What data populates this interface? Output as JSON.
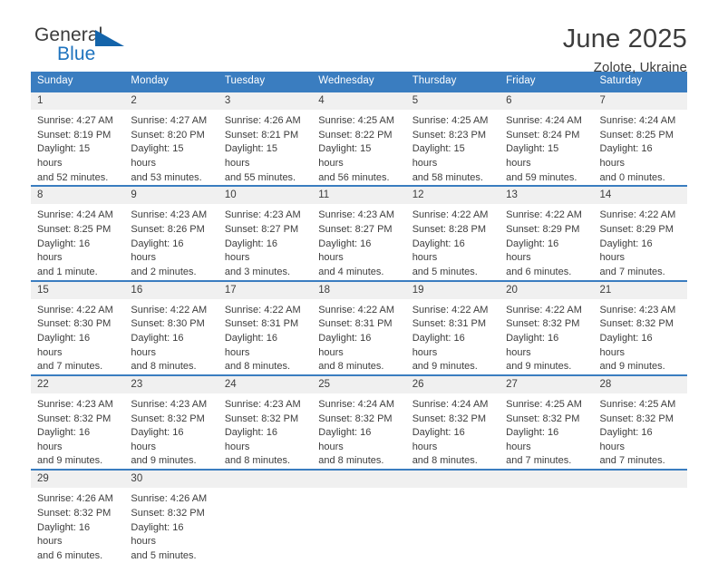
{
  "brand": {
    "name_part1": "General",
    "name_part2": "Blue",
    "accent_color": "#1464aa"
  },
  "header": {
    "title": "June 2025",
    "location": "Zolote, Ukraine"
  },
  "calendar": {
    "header_bg": "#3a7dc0",
    "daynum_bg": "#f0f0f0",
    "weekdays": [
      "Sunday",
      "Monday",
      "Tuesday",
      "Wednesday",
      "Thursday",
      "Friday",
      "Saturday"
    ],
    "weeks": [
      [
        {
          "day": "1",
          "sunrise": "Sunrise: 4:27 AM",
          "sunset": "Sunset: 8:19 PM",
          "daylight_line1": "Daylight: 15 hours",
          "daylight_line2": "and 52 minutes."
        },
        {
          "day": "2",
          "sunrise": "Sunrise: 4:27 AM",
          "sunset": "Sunset: 8:20 PM",
          "daylight_line1": "Daylight: 15 hours",
          "daylight_line2": "and 53 minutes."
        },
        {
          "day": "3",
          "sunrise": "Sunrise: 4:26 AM",
          "sunset": "Sunset: 8:21 PM",
          "daylight_line1": "Daylight: 15 hours",
          "daylight_line2": "and 55 minutes."
        },
        {
          "day": "4",
          "sunrise": "Sunrise: 4:25 AM",
          "sunset": "Sunset: 8:22 PM",
          "daylight_line1": "Daylight: 15 hours",
          "daylight_line2": "and 56 minutes."
        },
        {
          "day": "5",
          "sunrise": "Sunrise: 4:25 AM",
          "sunset": "Sunset: 8:23 PM",
          "daylight_line1": "Daylight: 15 hours",
          "daylight_line2": "and 58 minutes."
        },
        {
          "day": "6",
          "sunrise": "Sunrise: 4:24 AM",
          "sunset": "Sunset: 8:24 PM",
          "daylight_line1": "Daylight: 15 hours",
          "daylight_line2": "and 59 minutes."
        },
        {
          "day": "7",
          "sunrise": "Sunrise: 4:24 AM",
          "sunset": "Sunset: 8:25 PM",
          "daylight_line1": "Daylight: 16 hours",
          "daylight_line2": "and 0 minutes."
        }
      ],
      [
        {
          "day": "8",
          "sunrise": "Sunrise: 4:24 AM",
          "sunset": "Sunset: 8:25 PM",
          "daylight_line1": "Daylight: 16 hours",
          "daylight_line2": "and 1 minute."
        },
        {
          "day": "9",
          "sunrise": "Sunrise: 4:23 AM",
          "sunset": "Sunset: 8:26 PM",
          "daylight_line1": "Daylight: 16 hours",
          "daylight_line2": "and 2 minutes."
        },
        {
          "day": "10",
          "sunrise": "Sunrise: 4:23 AM",
          "sunset": "Sunset: 8:27 PM",
          "daylight_line1": "Daylight: 16 hours",
          "daylight_line2": "and 3 minutes."
        },
        {
          "day": "11",
          "sunrise": "Sunrise: 4:23 AM",
          "sunset": "Sunset: 8:27 PM",
          "daylight_line1": "Daylight: 16 hours",
          "daylight_line2": "and 4 minutes."
        },
        {
          "day": "12",
          "sunrise": "Sunrise: 4:22 AM",
          "sunset": "Sunset: 8:28 PM",
          "daylight_line1": "Daylight: 16 hours",
          "daylight_line2": "and 5 minutes."
        },
        {
          "day": "13",
          "sunrise": "Sunrise: 4:22 AM",
          "sunset": "Sunset: 8:29 PM",
          "daylight_line1": "Daylight: 16 hours",
          "daylight_line2": "and 6 minutes."
        },
        {
          "day": "14",
          "sunrise": "Sunrise: 4:22 AM",
          "sunset": "Sunset: 8:29 PM",
          "daylight_line1": "Daylight: 16 hours",
          "daylight_line2": "and 7 minutes."
        }
      ],
      [
        {
          "day": "15",
          "sunrise": "Sunrise: 4:22 AM",
          "sunset": "Sunset: 8:30 PM",
          "daylight_line1": "Daylight: 16 hours",
          "daylight_line2": "and 7 minutes."
        },
        {
          "day": "16",
          "sunrise": "Sunrise: 4:22 AM",
          "sunset": "Sunset: 8:30 PM",
          "daylight_line1": "Daylight: 16 hours",
          "daylight_line2": "and 8 minutes."
        },
        {
          "day": "17",
          "sunrise": "Sunrise: 4:22 AM",
          "sunset": "Sunset: 8:31 PM",
          "daylight_line1": "Daylight: 16 hours",
          "daylight_line2": "and 8 minutes."
        },
        {
          "day": "18",
          "sunrise": "Sunrise: 4:22 AM",
          "sunset": "Sunset: 8:31 PM",
          "daylight_line1": "Daylight: 16 hours",
          "daylight_line2": "and 8 minutes."
        },
        {
          "day": "19",
          "sunrise": "Sunrise: 4:22 AM",
          "sunset": "Sunset: 8:31 PM",
          "daylight_line1": "Daylight: 16 hours",
          "daylight_line2": "and 9 minutes."
        },
        {
          "day": "20",
          "sunrise": "Sunrise: 4:22 AM",
          "sunset": "Sunset: 8:32 PM",
          "daylight_line1": "Daylight: 16 hours",
          "daylight_line2": "and 9 minutes."
        },
        {
          "day": "21",
          "sunrise": "Sunrise: 4:23 AM",
          "sunset": "Sunset: 8:32 PM",
          "daylight_line1": "Daylight: 16 hours",
          "daylight_line2": "and 9 minutes."
        }
      ],
      [
        {
          "day": "22",
          "sunrise": "Sunrise: 4:23 AM",
          "sunset": "Sunset: 8:32 PM",
          "daylight_line1": "Daylight: 16 hours",
          "daylight_line2": "and 9 minutes."
        },
        {
          "day": "23",
          "sunrise": "Sunrise: 4:23 AM",
          "sunset": "Sunset: 8:32 PM",
          "daylight_line1": "Daylight: 16 hours",
          "daylight_line2": "and 9 minutes."
        },
        {
          "day": "24",
          "sunrise": "Sunrise: 4:23 AM",
          "sunset": "Sunset: 8:32 PM",
          "daylight_line1": "Daylight: 16 hours",
          "daylight_line2": "and 8 minutes."
        },
        {
          "day": "25",
          "sunrise": "Sunrise: 4:24 AM",
          "sunset": "Sunset: 8:32 PM",
          "daylight_line1": "Daylight: 16 hours",
          "daylight_line2": "and 8 minutes."
        },
        {
          "day": "26",
          "sunrise": "Sunrise: 4:24 AM",
          "sunset": "Sunset: 8:32 PM",
          "daylight_line1": "Daylight: 16 hours",
          "daylight_line2": "and 8 minutes."
        },
        {
          "day": "27",
          "sunrise": "Sunrise: 4:25 AM",
          "sunset": "Sunset: 8:32 PM",
          "daylight_line1": "Daylight: 16 hours",
          "daylight_line2": "and 7 minutes."
        },
        {
          "day": "28",
          "sunrise": "Sunrise: 4:25 AM",
          "sunset": "Sunset: 8:32 PM",
          "daylight_line1": "Daylight: 16 hours",
          "daylight_line2": "and 7 minutes."
        }
      ],
      [
        {
          "day": "29",
          "sunrise": "Sunrise: 4:26 AM",
          "sunset": "Sunset: 8:32 PM",
          "daylight_line1": "Daylight: 16 hours",
          "daylight_line2": "and 6 minutes."
        },
        {
          "day": "30",
          "sunrise": "Sunrise: 4:26 AM",
          "sunset": "Sunset: 8:32 PM",
          "daylight_line1": "Daylight: 16 hours",
          "daylight_line2": "and 5 minutes."
        },
        {
          "day": "",
          "sunrise": "",
          "sunset": "",
          "daylight_line1": "",
          "daylight_line2": ""
        },
        {
          "day": "",
          "sunrise": "",
          "sunset": "",
          "daylight_line1": "",
          "daylight_line2": ""
        },
        {
          "day": "",
          "sunrise": "",
          "sunset": "",
          "daylight_line1": "",
          "daylight_line2": ""
        },
        {
          "day": "",
          "sunrise": "",
          "sunset": "",
          "daylight_line1": "",
          "daylight_line2": ""
        },
        {
          "day": "",
          "sunrise": "",
          "sunset": "",
          "daylight_line1": "",
          "daylight_line2": ""
        }
      ]
    ]
  }
}
